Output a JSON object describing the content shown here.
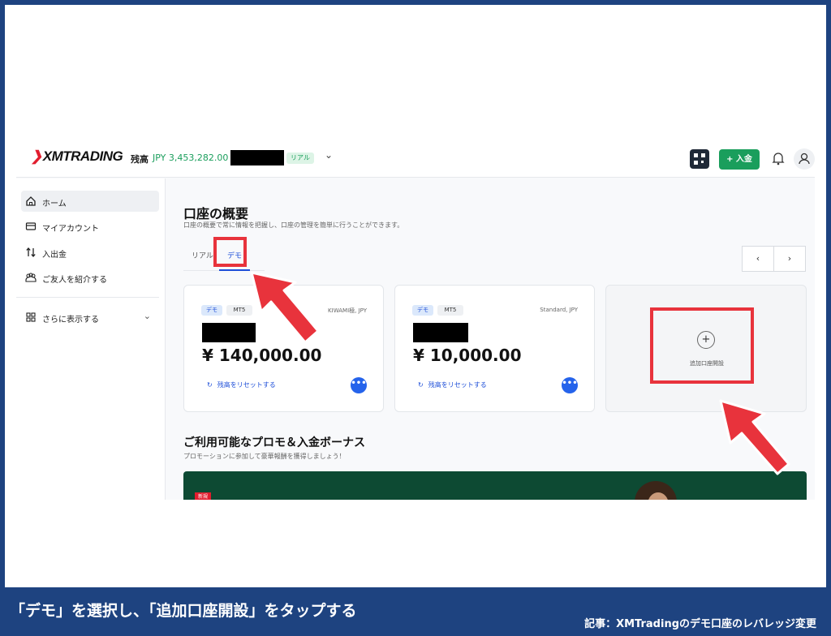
{
  "header": {
    "logo": "XMTRADING",
    "balance_label": "残高",
    "balance_value": "JPY 3,453,282.00",
    "account_type_badge": "リアル",
    "deposit_button": "+ 入金"
  },
  "sidebar": {
    "items": [
      {
        "label": "ホーム",
        "icon": "home-icon",
        "active": true
      },
      {
        "label": "マイアカウント",
        "icon": "card-icon"
      },
      {
        "label": "入出金",
        "icon": "transfer-icon"
      },
      {
        "label": "ご友人を紹介する",
        "icon": "people-icon"
      }
    ],
    "more_label": "さらに表示する"
  },
  "main": {
    "title": "口座の概要",
    "subtitle": "口座の概要で常に情報を把握し、口座の管理を簡単に行うことができます。",
    "tabs": [
      {
        "label": "リアル",
        "active": false
      },
      {
        "label": "デモ",
        "active": true
      }
    ],
    "pager_prev": "‹",
    "pager_next": "›",
    "accounts": [
      {
        "badge_demo": "デモ",
        "badge_platform": "MT5",
        "type": "KIWAMI極, JPY",
        "amount": "¥ 140,000.00",
        "reset_label": "残高をリセットする",
        "more": "•••"
      },
      {
        "badge_demo": "デモ",
        "badge_platform": "MT5",
        "type": "Standard, JPY",
        "amount": "¥ 10,000.00",
        "reset_label": "残高をリセットする",
        "more": "•••"
      }
    ],
    "add_account": {
      "icon_text": "+",
      "label": "追加口座開設"
    },
    "promo_title": "ご利用可能なプロモ＆入金ボーナス",
    "promo_subtitle": "プロモーションに参加して豪華報酬を獲得しましょう！",
    "promo_new_badge": "新規"
  },
  "caption": {
    "main": "「デモ」を選択し、「追加口座開設」をタップする",
    "source": "記事：XMTradingのデモ口座のレバレッジ変更"
  },
  "colors": {
    "accent_green": "#1a9e5c",
    "accent_blue": "#1d4ed8",
    "highlight_red": "#e8333c",
    "caption_bar": "#1e4380"
  }
}
